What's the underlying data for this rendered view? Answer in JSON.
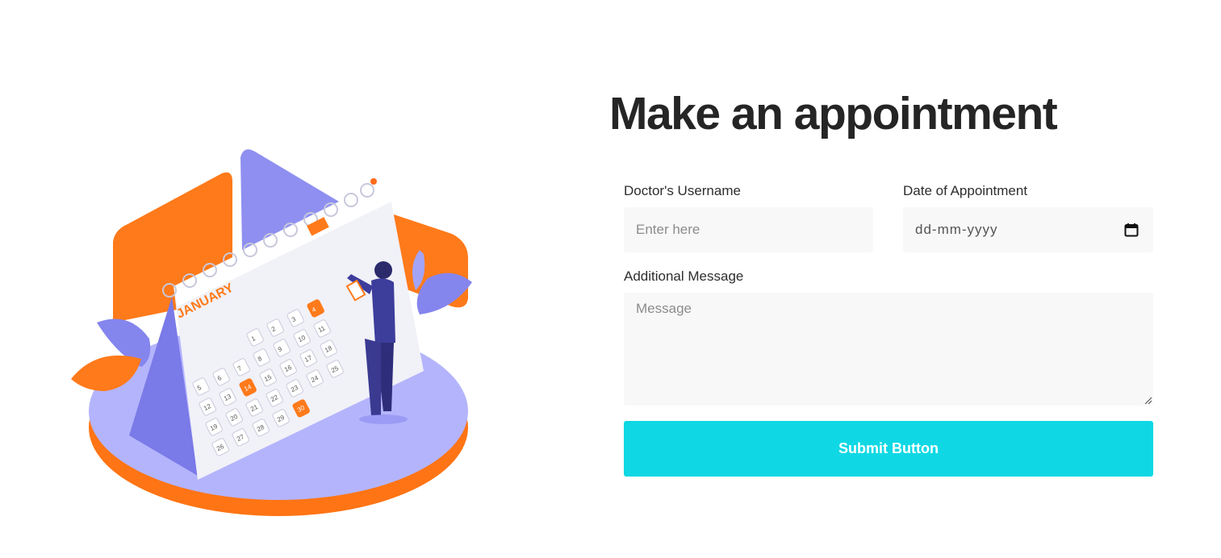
{
  "page": {
    "title": "Make an appointment"
  },
  "form": {
    "doctor_username": {
      "label": "Doctor's Username",
      "placeholder": "Enter here"
    },
    "date": {
      "label": "Date of Appointment",
      "placeholder": "dd-mm-yyyy",
      "icon": "calendar-icon"
    },
    "message": {
      "label": "Additional Message",
      "placeholder": "Message"
    },
    "submit_label": "Submit Button"
  },
  "illustration": {
    "month_label": "JANUARY",
    "calendar_days": [
      "1",
      "2",
      "3",
      "4",
      "5",
      "6",
      "7",
      "8",
      "9",
      "10",
      "11",
      "12",
      "13",
      "14",
      "15",
      "16",
      "17",
      "18",
      "19",
      "20",
      "21",
      "22",
      "23",
      "24",
      "25",
      "26",
      "27",
      "28",
      "29",
      "30"
    ],
    "highlighted_days": [
      "4",
      "14",
      "30"
    ]
  },
  "colors": {
    "accent": "#0fd8e4",
    "orange": "#ff7a1a",
    "purple": "#8e8ff0",
    "title": "#252525",
    "field_bg": "#f8f8f8"
  }
}
